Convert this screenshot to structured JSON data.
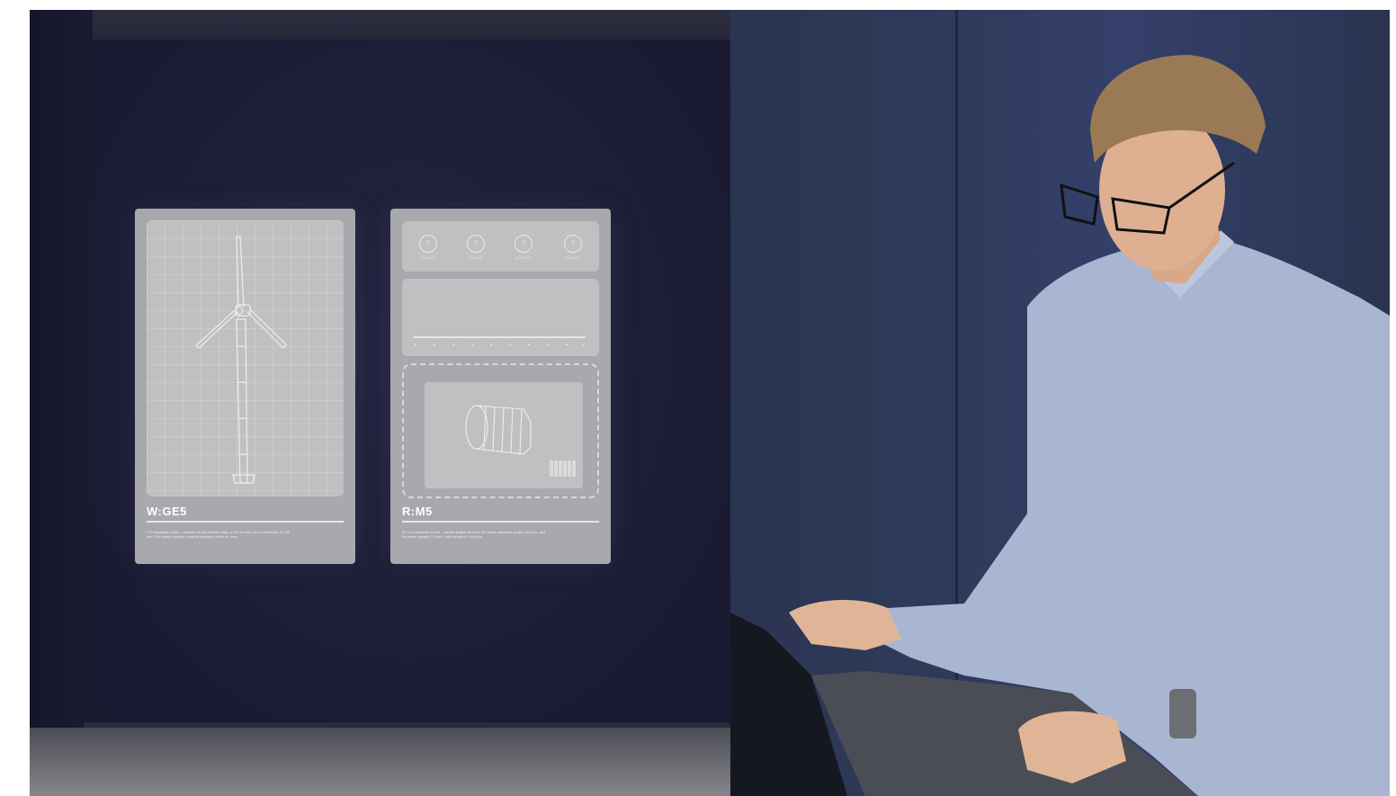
{
  "panels": [
    {
      "title": "W:GE5",
      "description": "1.5-megawatt model - consists of 116-ft blades atop a 212-ft tower for a total height of 328 feet. The blades sweep a vertical airspace under an acre."
    },
    {
      "title": "R:M5",
      "description": "86 1.5-megawatt model - nacelle weighs 56 tons, the blade assembly weighs 36 tons, and the tower weighs 71 tons - total weight of 164 tons.",
      "stats": [
        {
          "value": "0",
          "label": "TEMPS"
        },
        {
          "value": "0",
          "label": "LABOR"
        },
        {
          "value": "0",
          "label": "OUTPUT"
        },
        {
          "value": "0",
          "label": "POWER"
        }
      ]
    }
  ],
  "colors": {
    "room_wall": "#1c1d35",
    "panel_bg": "#a9a9ad",
    "panel_screen": "#c0c0c3",
    "photo_bg": "#2f3a5a",
    "shirt": "#a9b6d2"
  }
}
